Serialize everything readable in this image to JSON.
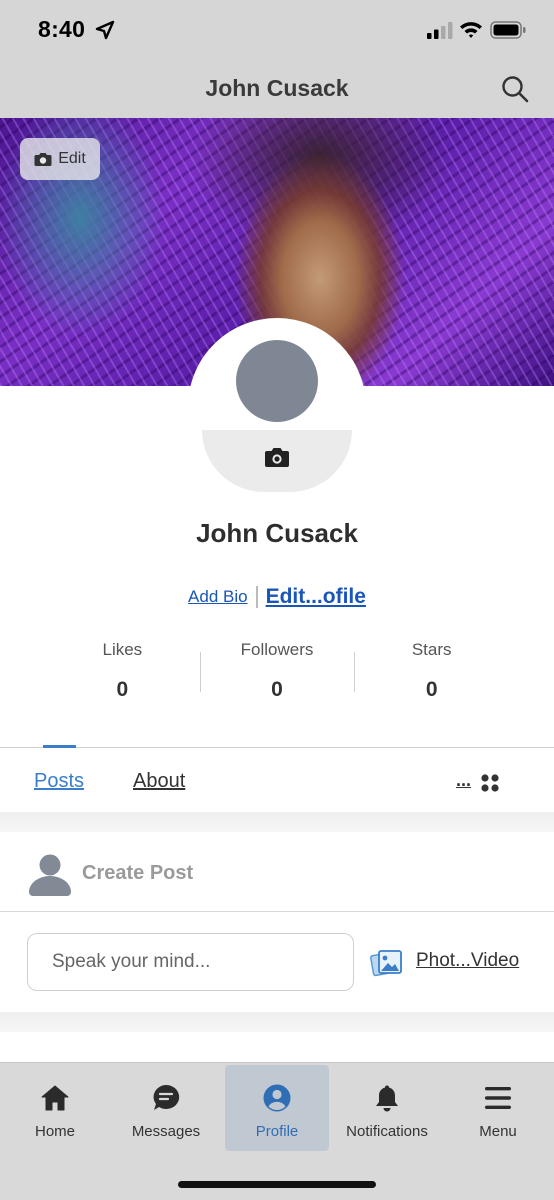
{
  "status": {
    "time": "8:40"
  },
  "header": {
    "title": "John Cusack"
  },
  "cover": {
    "edit_label": "Edit"
  },
  "profile": {
    "name": "John Cusack",
    "add_bio": "Add Bio",
    "edit_profile": "Edit...ofile"
  },
  "stats": [
    {
      "label": "Likes",
      "value": "0"
    },
    {
      "label": "Followers",
      "value": "0"
    },
    {
      "label": "Stars",
      "value": "0"
    }
  ],
  "tabs": {
    "posts": "Posts",
    "about": "About",
    "more": "..."
  },
  "create_post": {
    "label": "Create Post",
    "placeholder": "Speak your mind...",
    "photo_video": "Phot...Video"
  },
  "nav": [
    {
      "label": "Home",
      "icon": "home-icon"
    },
    {
      "label": "Messages",
      "icon": "message-icon"
    },
    {
      "label": "Profile",
      "icon": "profile-icon",
      "active": true
    },
    {
      "label": "Notifications",
      "icon": "bell-icon"
    },
    {
      "label": "Menu",
      "icon": "menu-icon"
    }
  ],
  "colors": {
    "accent": "#3a7ec9",
    "link": "#1a55b8",
    "bar_bg": "#d6d6d6",
    "active_nav_bg": "#c0c8d1"
  }
}
